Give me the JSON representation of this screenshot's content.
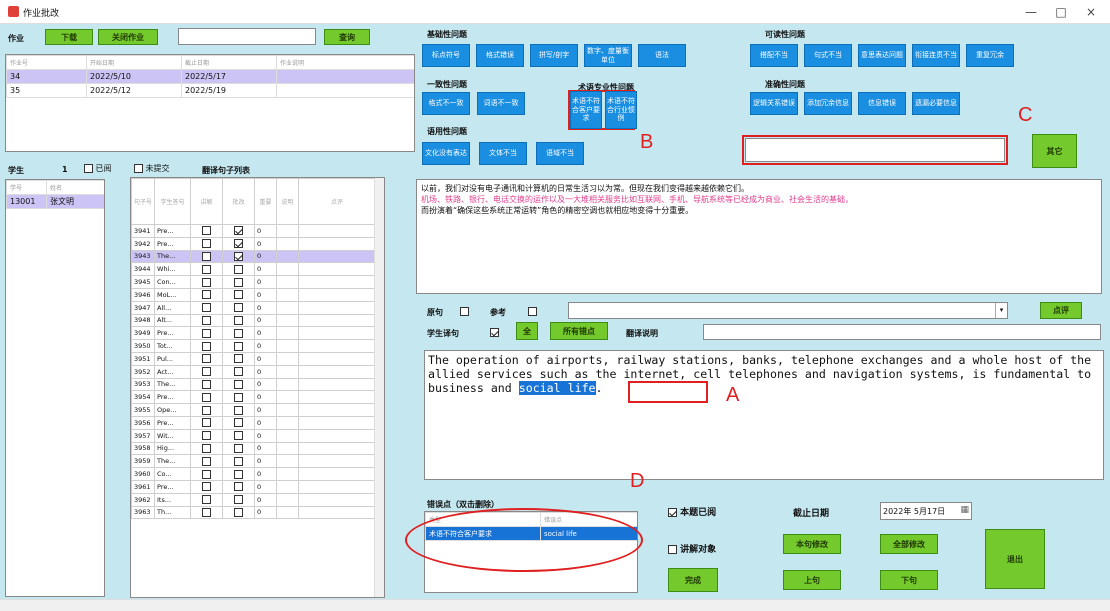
{
  "window": {
    "title": "作业批改",
    "min": "—",
    "max": "□",
    "close": "×"
  },
  "top": {
    "hw_label": "作业",
    "download": "下载",
    "close_hw": "关闭作业",
    "query": "查询"
  },
  "hw_table": {
    "headers": [
      "作业号",
      "开始日期",
      "截止日期",
      "作业说明"
    ],
    "rows": [
      [
        "34",
        "2022/5/10",
        "2022/5/17",
        ""
      ],
      [
        "35",
        "2022/5/12",
        "2022/5/19",
        ""
      ]
    ]
  },
  "student": {
    "label": "学生",
    "count": "1",
    "viewed": "已阅",
    "unsubmitted": "未提交",
    "list_title": "翻译句子列表",
    "headers": [
      "学号",
      "姓名"
    ],
    "rows": [
      [
        "13001",
        "张文明"
      ]
    ]
  },
  "trans": {
    "headers": [
      "句子号",
      "学生答句",
      "讲解",
      "批改",
      "重要",
      "说明",
      "点评"
    ],
    "rows": [
      {
        "num": "3941",
        "text": "Pre...",
        "jj": false,
        "pg": true,
        "zy": "0"
      },
      {
        "num": "3942",
        "text": "Pre...",
        "jj": false,
        "pg": true,
        "zy": "0"
      },
      {
        "num": "3943",
        "text": "The...",
        "jj": false,
        "pg": true,
        "zy": "0"
      },
      {
        "num": "3944",
        "text": "Whi...",
        "jj": false,
        "pg": false,
        "zy": "0"
      },
      {
        "num": "3945",
        "text": "Con...",
        "jj": false,
        "pg": false,
        "zy": "0"
      },
      {
        "num": "3946",
        "text": "MoL...",
        "jj": false,
        "pg": false,
        "zy": "0"
      },
      {
        "num": "3947",
        "text": "All...",
        "jj": false,
        "pg": false,
        "zy": "0"
      },
      {
        "num": "3948",
        "text": "Alt...",
        "jj": false,
        "pg": false,
        "zy": "0"
      },
      {
        "num": "3949",
        "text": "Pre...",
        "jj": false,
        "pg": false,
        "zy": "0"
      },
      {
        "num": "3950",
        "text": "Tot...",
        "jj": false,
        "pg": false,
        "zy": "0"
      },
      {
        "num": "3951",
        "text": "Pul...",
        "jj": false,
        "pg": false,
        "zy": "0"
      },
      {
        "num": "3952",
        "text": "Act...",
        "jj": false,
        "pg": false,
        "zy": "0"
      },
      {
        "num": "3953",
        "text": "The...",
        "jj": false,
        "pg": false,
        "zy": "0"
      },
      {
        "num": "3954",
        "text": "Pre...",
        "jj": false,
        "pg": false,
        "zy": "0"
      },
      {
        "num": "3955",
        "text": "Ope...",
        "jj": false,
        "pg": false,
        "zy": "0"
      },
      {
        "num": "3956",
        "text": "Pre...",
        "jj": false,
        "pg": false,
        "zy": "0"
      },
      {
        "num": "3957",
        "text": "Wit...",
        "jj": false,
        "pg": false,
        "zy": "0"
      },
      {
        "num": "3958",
        "text": "Hig...",
        "jj": false,
        "pg": false,
        "zy": "0"
      },
      {
        "num": "3959",
        "text": "The...",
        "jj": false,
        "pg": false,
        "zy": "0"
      },
      {
        "num": "3960",
        "text": "Co...",
        "jj": false,
        "pg": false,
        "zy": "0"
      },
      {
        "num": "3961",
        "text": "Pre...",
        "jj": false,
        "pg": false,
        "zy": "0"
      },
      {
        "num": "3962",
        "text": "Its...",
        "jj": false,
        "pg": false,
        "zy": "0"
      },
      {
        "num": "3963",
        "text": "Th...",
        "jj": false,
        "pg": false,
        "zy": "0"
      }
    ]
  },
  "errors": {
    "basic": {
      "title": "基础性问题",
      "buttons": [
        "标点符号",
        "格式错误",
        "拼写/剖字",
        "数字、度量衡单位",
        "语法"
      ]
    },
    "readability": {
      "title": "可读性问题",
      "buttons": [
        "搭配不当",
        "句式不当",
        "意思表达问题",
        "衔接连贯不当",
        "重复冗余"
      ]
    },
    "consistency": {
      "title": "一致性问题",
      "buttons": [
        "格式不一致",
        "词语不一致"
      ]
    },
    "term": {
      "title": "术语专业性问题",
      "buttons": [
        "术语不符合客户要求",
        "术语不符合行业惯例"
      ]
    },
    "accuracy": {
      "title": "准确性问题",
      "buttons": [
        "逻辑关系错误",
        "添加冗余信息",
        "信息错误",
        "遗漏必要信息"
      ]
    },
    "usage": {
      "title": "语用性问题",
      "buttons": [
        "文化没有表达",
        "文体不当",
        "语域不当"
      ]
    },
    "other_btn": "其它"
  },
  "source_text": {
    "line1": "以前，我们对没有电子通讯和计算机的日常生活习以为常。但现在我们变得越来越依赖它们。",
    "line2": "机场、铁路、银行、电话交换的运作以及一大堆相关服务比如互联网、手机、导航系统等已经成为商业、社会生活的基础，",
    "line3": "而扮演着“确保这些系统正常运转”角色的精密空调也就相应地变得十分重要。"
  },
  "mid": {
    "original": "原句",
    "reference": "参考",
    "review": "点评",
    "student_trans": "学生译句",
    "all": "全",
    "all_errors": "所有错点",
    "trans_note": "翻译说明"
  },
  "student_text": {
    "before": "The operation of airports, railway stations, banks, telephone exchanges and a whole host of the allied services such as the internet, cell telephones and navigation systems, is fundamental to business and ",
    "highlight": "social life",
    "after": "."
  },
  "err_points": {
    "title": "错误点（双击删除）",
    "headers": [
      "类型",
      "错误点"
    ],
    "rows": [
      [
        "术语不符合客户要求",
        "social life"
      ]
    ]
  },
  "bottom": {
    "viewed": "本题已阅",
    "explain_obj": "讲解对象",
    "deadline": "截止日期",
    "date": "2022年 5月17日",
    "this_modify": "本句修改",
    "all_modify": "全部修改",
    "done": "完成",
    "prev": "上句",
    "next": "下句",
    "exit": "退出"
  },
  "annotations": {
    "a": "A",
    "b": "B",
    "c": "C",
    "d": "D"
  }
}
